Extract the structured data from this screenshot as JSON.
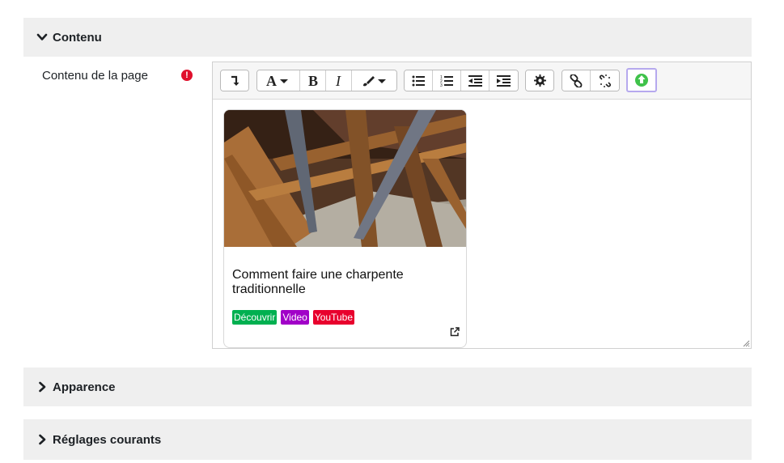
{
  "sections": {
    "contenu": "Contenu",
    "apparence": "Apparence",
    "reglages": "Réglages courants"
  },
  "field": {
    "label": "Contenu de la page",
    "required_icon": "exclamation-circle-icon"
  },
  "toolbar": {
    "icons": [
      "toolbar-toggle-icon",
      "font-icon",
      "bold-icon",
      "italic-icon",
      "brush-icon",
      "unordered-list-icon",
      "ordered-list-icon",
      "outdent-icon",
      "indent-icon",
      "gear-icon",
      "link-icon",
      "unlink-icon",
      "plugin-icon"
    ]
  },
  "card": {
    "title": "Comment faire une charpente traditionnelle",
    "tags": [
      {
        "label": "Découvrir",
        "color": "#00b050"
      },
      {
        "label": "Video",
        "color": "#a100c8"
      },
      {
        "label": "YouTube",
        "color": "#e8002d"
      }
    ]
  }
}
